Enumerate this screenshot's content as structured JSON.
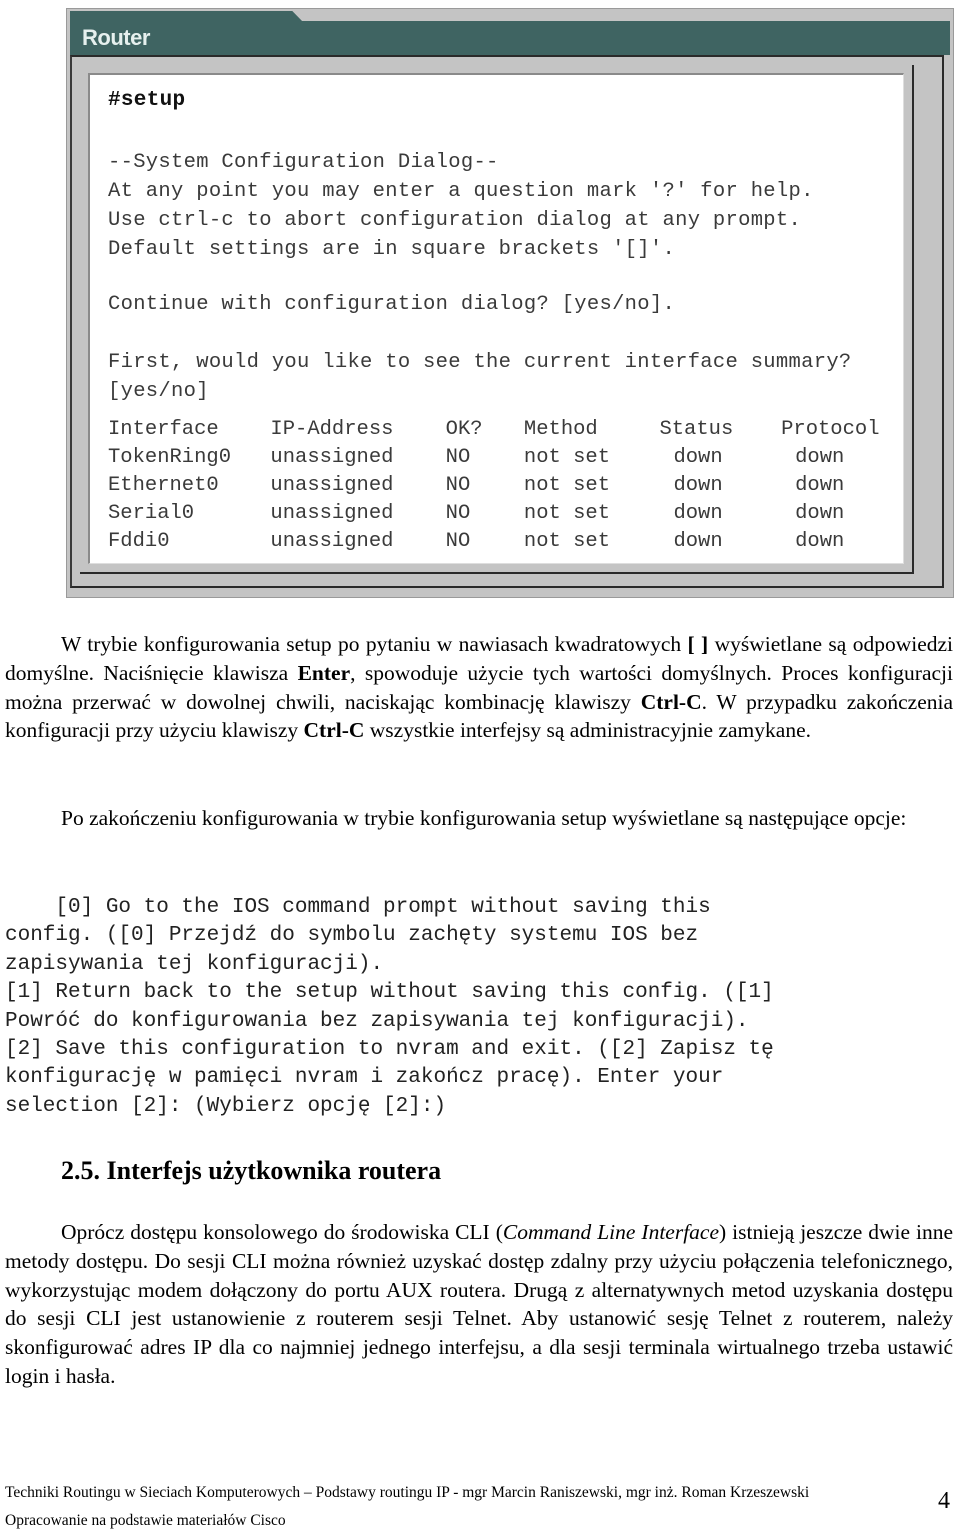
{
  "router_window": {
    "title": "Router",
    "command": "#setup",
    "dialog_lines": [
      "--System Configuration Dialog--",
      "At any point you may enter a question mark '?' for help.",
      "Use ctrl-c to abort configuration dialog at any prompt.",
      "Default settings are in square brackets '[]'."
    ],
    "continue_prompt": "Continue with configuration dialog? [yes/no].",
    "summary_prompt": [
      "First, would you like to see the current interface summary?",
      "[yes/no]"
    ],
    "interface_table": {
      "columns": [
        "Interface",
        "IP-Address",
        "OK?",
        "Method",
        "Status",
        "Protocol"
      ],
      "rows": [
        [
          "TokenRing0",
          "unassigned",
          "NO",
          "not set",
          "down",
          "down"
        ],
        [
          "Ethernet0",
          "unassigned",
          "NO",
          "not set",
          "down",
          "down"
        ],
        [
          "Serial0",
          "unassigned",
          "NO",
          "not set",
          "down",
          "down"
        ],
        [
          "Fddi0",
          "unassigned",
          "NO",
          "not set",
          "down",
          "down"
        ]
      ]
    }
  },
  "paragraph1": {
    "t1": "W trybie konfigurowania setup po pytaniu w nawiasach kwadratowych ",
    "b1": "[ ]",
    "t2": " wyświetlane są odpowiedzi domyślne. Naciśnięcie klawisza ",
    "b2": "Enter",
    "t3": ", spowoduje użycie tych wartości domyślnych. Proces konfiguracji można przerwać w dowolnej chwili, naciskając kombinację klawiszy ",
    "b3": "Ctrl-C",
    "t4": ". W przypadku zakończenia konfiguracji przy użyciu klawiszy ",
    "b4": "Ctrl-C",
    "t5": " wszystkie interfejsy są administracyjnie zamykane."
  },
  "paragraph2": "Po zakończeniu konfigurowania w trybie konfigurowania setup wyświetlane są następujące opcje:",
  "options_lines": [
    "    [0] Go to the IOS command prompt without saving this",
    "config. ([0] Przejdź do symbolu zachęty systemu IOS bez",
    "zapisywania tej konfiguracji).",
    "[1] Return back to the setup without saving this config. ([1]",
    "Powróć do konfigurowania bez zapisywania tej konfiguracji).",
    "[2] Save this configuration to nvram and exit. ([2] Zapisz tę",
    "konfigurację w pamięci nvram i zakończ pracę). Enter your",
    "selection [2]: (Wybierz opcję [2]:)"
  ],
  "section_heading": "2.5. Interfejs użytkownika routera",
  "paragraph3": {
    "t1": "Oprócz dostępu konsolowego do środowiska CLI (",
    "i1": "Command Line Interface",
    "t2": ") istnieją jeszcze dwie inne metody dostępu. Do sesji CLI można również uzyskać dostęp zdalny przy użyciu połączenia telefonicznego, wykorzystując modem dołączony do portu AUX routera. Drugą z alternatywnych metod uzyskania dostępu do sesji CLI jest ustanowienie z routerem sesji Telnet. Aby ustanowić sesję Telnet z routerem, należy skonfigurować adres IP dla co najmniej jednego interfejsu, a dla sesji terminala wirtualnego trzeba ustawić login i hasła."
  },
  "footer": {
    "line1": "Techniki Routingu w Sieciach Komputerowych – Podstawy routingu IP - mgr Marcin Raniszewski, mgr inż. Roman Krzeszewski",
    "line2": "Opracowanie na podstawie materiałów Cisco",
    "page_number": "4"
  }
}
